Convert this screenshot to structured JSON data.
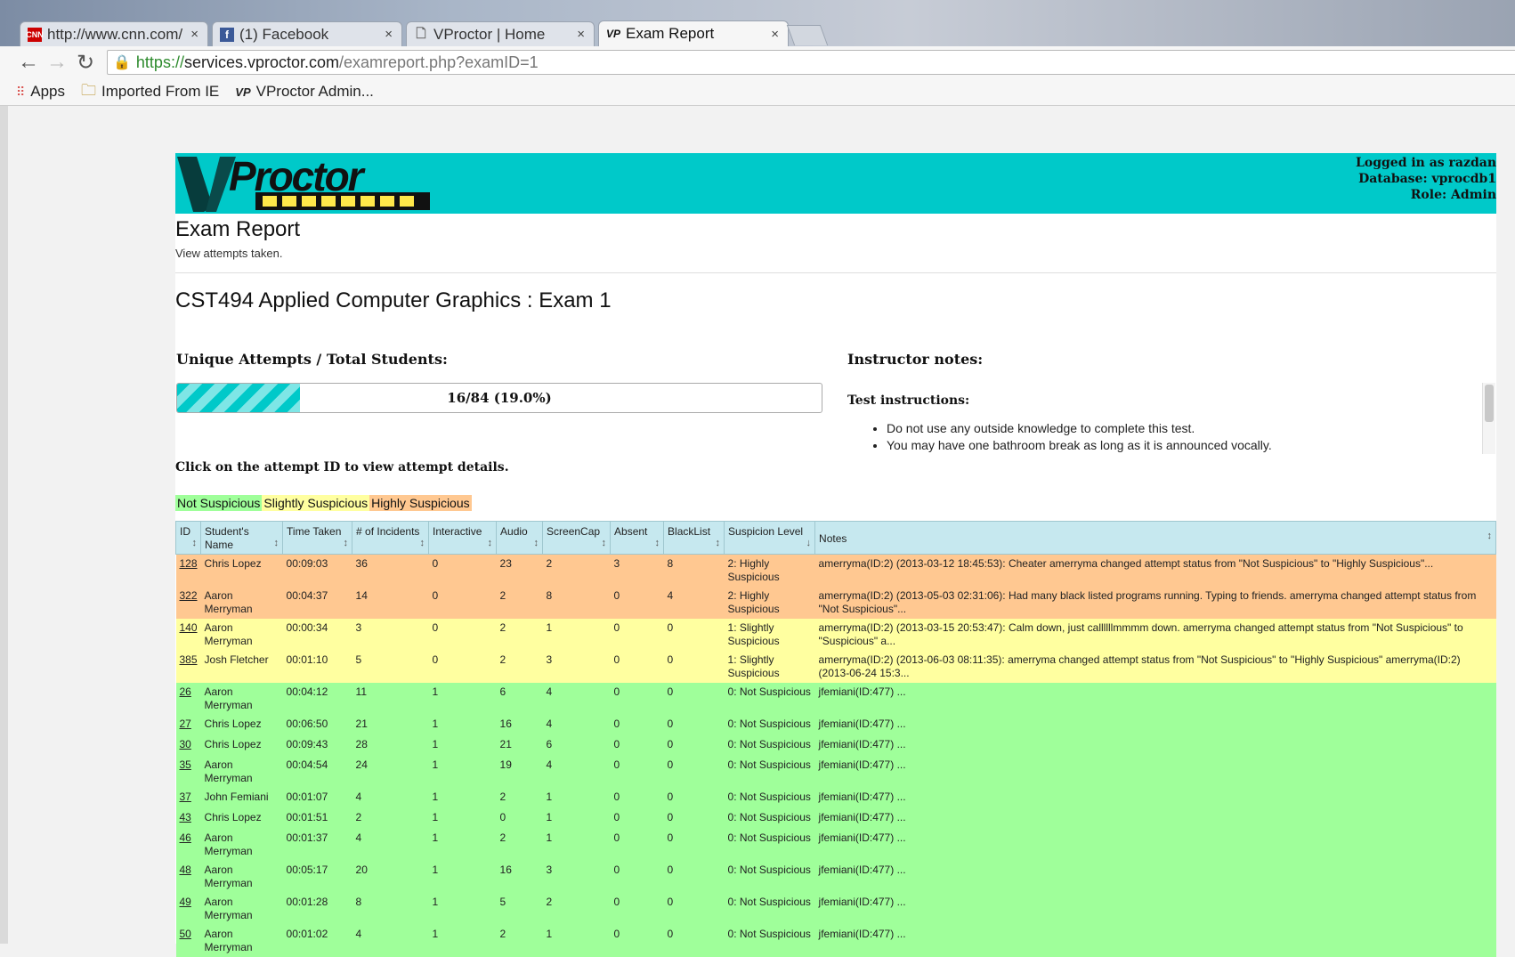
{
  "browser": {
    "tabs": [
      {
        "title": "http://www.cnn.com/",
        "favicon": "cnn-favicon"
      },
      {
        "title": "(1) Facebook",
        "favicon": "facebook-favicon"
      },
      {
        "title": "VProctor | Home",
        "favicon": "document-favicon"
      },
      {
        "title": "Exam Report",
        "favicon": "vproctor-favicon"
      }
    ],
    "url": {
      "scheme": "https://",
      "host": "services.vproctor.com",
      "path": "/examreport.php?examID=1"
    },
    "bookmarks": [
      "Apps",
      "Imported From IE",
      "VProctor Admin..."
    ]
  },
  "header": {
    "logo_text": "VProctor",
    "login": {
      "user": "Logged in as razdan",
      "database": "Database: vprocdb1",
      "role": "Role: Admin"
    }
  },
  "page": {
    "title": "Exam Report",
    "subtitle": "View attempts taken.",
    "exam_title": "CST494 Applied Computer Graphics : Exam 1",
    "unique_label": "Unique Attempts / Total Students:",
    "progress": {
      "text": "16/84 (19.0%)",
      "fraction": 0.19
    },
    "notes_label": "Instructor notes:",
    "instructions_label": "Test instructions:",
    "instructions": [
      "Do not use any outside knowledge to complete this test.",
      "You may have one bathroom break as long as it is announced vocally."
    ],
    "click_info": "Click on the attempt ID to view attempt details.",
    "legend": {
      "not": "Not Suspicious",
      "slightly": "Slightly Suspicious",
      "highly": "Highly Suspicious"
    },
    "colors": {
      "banner": "#00c9c9",
      "highly": "#ffc891",
      "slightly": "#ffffa0",
      "not": "#9fff9a",
      "header": "#c6e8ef"
    }
  },
  "table": {
    "headers": [
      "ID",
      "Student's Name",
      "Time Taken",
      "# of Incidents",
      "Interactive",
      "Audio",
      "ScreenCap",
      "Absent",
      "BlackList",
      "Suspicion Level",
      "Notes"
    ],
    "rows": [
      {
        "id": "128",
        "name": "Chris Lopez",
        "time": "00:09:03",
        "incidents": "36",
        "interactive": "0",
        "audio": "23",
        "screencap": "2",
        "absent": "3",
        "blacklist": "8",
        "level": "2: Highly Suspicious",
        "notes": "amerryma(ID:2) (2013-03-12 18:45:53): Cheater amerryma changed attempt status from \"Not Suspicious\" to \"Highly Suspicious\"...",
        "class": "hs"
      },
      {
        "id": "322",
        "name": "Aaron Merryman",
        "time": "00:04:37",
        "incidents": "14",
        "interactive": "0",
        "audio": "2",
        "screencap": "8",
        "absent": "0",
        "blacklist": "4",
        "level": "2: Highly Suspicious",
        "notes": "amerryma(ID:2) (2013-05-03 02:31:06): Had many black listed programs running. Typing to friends. amerryma changed attempt status from \"Not Suspicious\"...",
        "class": "hs"
      },
      {
        "id": "140",
        "name": "Aaron Merryman",
        "time": "00:00:34",
        "incidents": "3",
        "interactive": "0",
        "audio": "2",
        "screencap": "1",
        "absent": "0",
        "blacklist": "0",
        "level": "1: Slightly Suspicious",
        "notes": "amerryma(ID:2) (2013-03-15 20:53:47): Calm down, just callllllmmmm down. amerryma changed attempt status from \"Not Suspicious\" to \"Suspicious\" a...",
        "class": "ss"
      },
      {
        "id": "385",
        "name": "Josh Fletcher",
        "time": "00:01:10",
        "incidents": "5",
        "interactive": "0",
        "audio": "2",
        "screencap": "3",
        "absent": "0",
        "blacklist": "0",
        "level": "1: Slightly Suspicious",
        "notes": "amerryma(ID:2) (2013-06-03 08:11:35): amerryma changed attempt status from \"Not Suspicious\" to \"Highly Suspicious\" amerryma(ID:2) (2013-06-24 15:3...",
        "class": "ss"
      },
      {
        "id": "26",
        "name": "Aaron Merryman",
        "time": "00:04:12",
        "incidents": "11",
        "interactive": "1",
        "audio": "6",
        "screencap": "4",
        "absent": "0",
        "blacklist": "0",
        "level": "0: Not Suspicious",
        "notes": "jfemiani(ID:477) ...",
        "class": "ns"
      },
      {
        "id": "27",
        "name": "Chris Lopez",
        "time": "00:06:50",
        "incidents": "21",
        "interactive": "1",
        "audio": "16",
        "screencap": "4",
        "absent": "0",
        "blacklist": "0",
        "level": "0: Not Suspicious",
        "notes": "jfemiani(ID:477) ...",
        "class": "ns"
      },
      {
        "id": "30",
        "name": "Chris Lopez",
        "time": "00:09:43",
        "incidents": "28",
        "interactive": "1",
        "audio": "21",
        "screencap": "6",
        "absent": "0",
        "blacklist": "0",
        "level": "0: Not Suspicious",
        "notes": "jfemiani(ID:477) ...",
        "class": "ns"
      },
      {
        "id": "35",
        "name": "Aaron Merryman",
        "time": "00:04:54",
        "incidents": "24",
        "interactive": "1",
        "audio": "19",
        "screencap": "4",
        "absent": "0",
        "blacklist": "0",
        "level": "0: Not Suspicious",
        "notes": "jfemiani(ID:477) ...",
        "class": "ns"
      },
      {
        "id": "37",
        "name": "John Femiani",
        "time": "00:01:07",
        "incidents": "4",
        "interactive": "1",
        "audio": "2",
        "screencap": "1",
        "absent": "0",
        "blacklist": "0",
        "level": "0: Not Suspicious",
        "notes": "jfemiani(ID:477) ...",
        "class": "ns"
      },
      {
        "id": "43",
        "name": "Chris Lopez",
        "time": "00:01:51",
        "incidents": "2",
        "interactive": "1",
        "audio": "0",
        "screencap": "1",
        "absent": "0",
        "blacklist": "0",
        "level": "0: Not Suspicious",
        "notes": "jfemiani(ID:477) ...",
        "class": "ns"
      },
      {
        "id": "46",
        "name": "Aaron Merryman",
        "time": "00:01:37",
        "incidents": "4",
        "interactive": "1",
        "audio": "2",
        "screencap": "1",
        "absent": "0",
        "blacklist": "0",
        "level": "0: Not Suspicious",
        "notes": "jfemiani(ID:477) ...",
        "class": "ns"
      },
      {
        "id": "48",
        "name": "Aaron Merryman",
        "time": "00:05:17",
        "incidents": "20",
        "interactive": "1",
        "audio": "16",
        "screencap": "3",
        "absent": "0",
        "blacklist": "0",
        "level": "0: Not Suspicious",
        "notes": "jfemiani(ID:477) ...",
        "class": "ns"
      },
      {
        "id": "49",
        "name": "Aaron Merryman",
        "time": "00:01:28",
        "incidents": "8",
        "interactive": "1",
        "audio": "5",
        "screencap": "2",
        "absent": "0",
        "blacklist": "0",
        "level": "0: Not Suspicious",
        "notes": "jfemiani(ID:477) ...",
        "class": "ns"
      },
      {
        "id": "50",
        "name": "Aaron Merryman",
        "time": "00:01:02",
        "incidents": "4",
        "interactive": "1",
        "audio": "2",
        "screencap": "1",
        "absent": "0",
        "blacklist": "0",
        "level": "0: Not Suspicious",
        "notes": "jfemiani(ID:477) ...",
        "class": "ns"
      }
    ]
  }
}
